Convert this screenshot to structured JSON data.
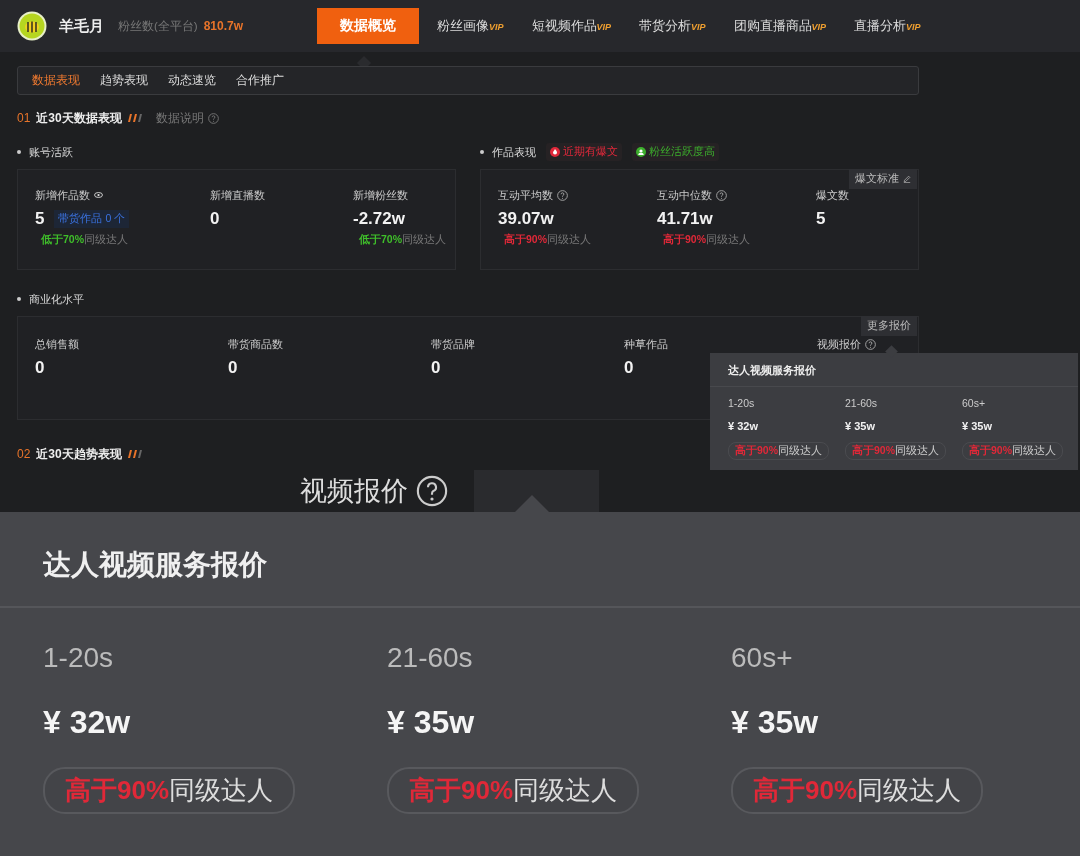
{
  "header": {
    "name": "羊毛月",
    "fans_label": "粉丝数(全平台)",
    "fans_value": "810.7w"
  },
  "nav": [
    {
      "label": "数据概览",
      "selected": true
    },
    {
      "label": "粉丝画像",
      "vip": "VIP",
      "selected": false
    },
    {
      "label": "短视频作品",
      "vip": "VIP",
      "selected": false
    },
    {
      "label": "带货分析",
      "vip": "VIP",
      "selected": false
    },
    {
      "label": "团购直播商品",
      "vip": "VIP",
      "selected": false
    },
    {
      "label": "直播分析",
      "vip": "VIP",
      "selected": false
    }
  ],
  "subtabs": [
    {
      "label": "数据表现",
      "selected": true
    },
    {
      "label": "趋势表现",
      "selected": false
    },
    {
      "label": "动态速览",
      "selected": false
    },
    {
      "label": "合作推广",
      "selected": false
    }
  ],
  "section_1": {
    "number": "01",
    "title": "近30天数据表现",
    "help": "数据说明"
  },
  "account": {
    "title": "账号活跃",
    "metrics": [
      {
        "label": "新增作品数",
        "kind": "eye",
        "value": "5",
        "tag": "带货作品 0 个",
        "compare": {
          "kind": "low",
          "part": "低于70%",
          "rest": "同级达人"
        }
      },
      {
        "label": "新增直播数",
        "value": "0"
      },
      {
        "label": "新增粉丝数",
        "value": "-2.72w",
        "compare": {
          "kind": "low",
          "part": "低于70%",
          "rest": "同级达人"
        }
      }
    ]
  },
  "works": {
    "title": "作品表现",
    "badges": [
      {
        "label": "近期有爆文",
        "kind": "fire",
        "color": "#e0283a"
      },
      {
        "label": "粉丝活跃度高",
        "kind": "fans",
        "color": "#3cae2c"
      }
    ],
    "action": "爆文标准",
    "metrics": [
      {
        "label": "互动平均数",
        "kind": "help",
        "value": "39.07w",
        "compare": {
          "kind": "high",
          "part": "高于90%",
          "rest": "同级达人"
        }
      },
      {
        "label": "互动中位数",
        "kind": "help",
        "value": "41.71w",
        "compare": {
          "kind": "high",
          "part": "高于90%",
          "rest": "同级达人"
        }
      },
      {
        "label": "爆文数",
        "value": "5"
      }
    ]
  },
  "commerce": {
    "title": "商业化水平",
    "action": "更多报价",
    "metrics": [
      {
        "label": "总销售额",
        "value": "0"
      },
      {
        "label": "带货商品数",
        "value": "0"
      },
      {
        "label": "带货品牌",
        "value": "0"
      },
      {
        "label": "种草作品",
        "value": "0"
      },
      {
        "label": "视频报价",
        "kind": "help"
      }
    ]
  },
  "tooltip": {
    "title": "达人视频服务报价",
    "prices": [
      {
        "range": "1-20s",
        "price": "¥ 32w",
        "compare": {
          "kind": "high",
          "part": "高于90%",
          "rest": "同级达人"
        }
      },
      {
        "range": "21-60s",
        "price": "¥ 35w",
        "compare": {
          "kind": "high",
          "part": "高于90%",
          "rest": "同级达人"
        }
      },
      {
        "range": "60s+",
        "price": "¥ 35w",
        "compare": {
          "kind": "high",
          "part": "高于90%",
          "rest": "同级达人"
        }
      }
    ]
  },
  "section_2": {
    "number": "02",
    "title": "近30天趋势表现"
  },
  "zoom": {
    "label": "视频报价",
    "title": "达人视频服务报价",
    "prices": [
      {
        "range": "1-20s",
        "price": "¥ 32w",
        "compare": {
          "kind": "high",
          "part": "高于90%",
          "rest": "同级达人"
        }
      },
      {
        "range": "21-60s",
        "price": "¥ 35w",
        "compare": {
          "kind": "high",
          "part": "高于90%",
          "rest": "同级达人"
        }
      },
      {
        "range": "60s+",
        "price": "¥ 35w",
        "compare": {
          "kind": "high",
          "part": "高于90%",
          "rest": "同级达人"
        }
      }
    ]
  }
}
